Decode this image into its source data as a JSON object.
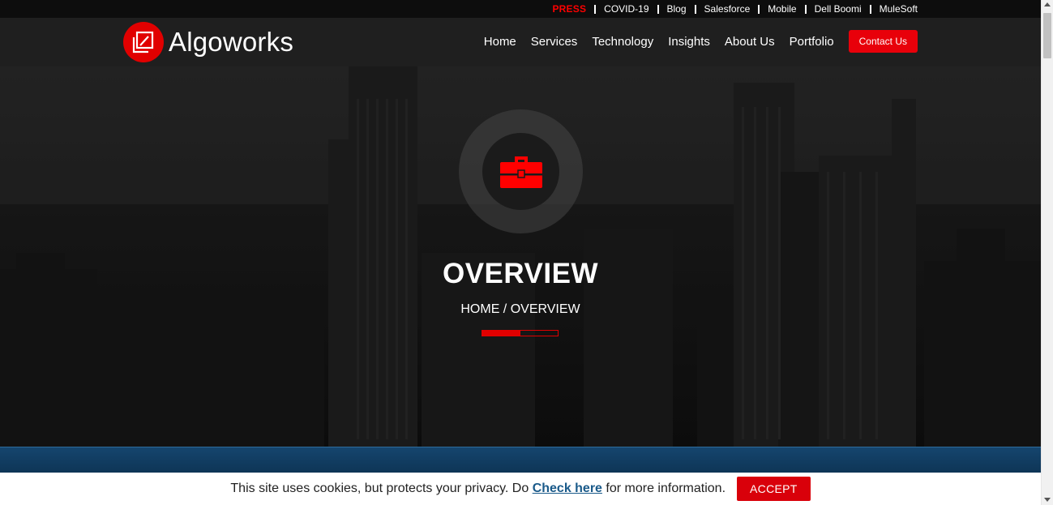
{
  "topbar": {
    "press": "PRESS",
    "links": [
      "COVID-19",
      "Blog",
      "Salesforce",
      "Mobile",
      "Dell Boomi",
      "MuleSoft"
    ]
  },
  "brand": {
    "name": "Algoworks",
    "accent": "#e10000"
  },
  "nav": {
    "items": [
      "Home",
      "Services",
      "Technology",
      "Insights",
      "About Us",
      "Portfolio"
    ],
    "contact_label": "Contact Us"
  },
  "hero": {
    "icon": "briefcase-icon",
    "title": "OVERVIEW",
    "breadcrumb": "HOME / OVERVIEW",
    "progress": 0.5
  },
  "cookie": {
    "text_before": "This site uses cookies, but protects your privacy. Do ",
    "link": "Check here",
    "text_after": " for more information.",
    "accept_label": "ACCEPT"
  }
}
